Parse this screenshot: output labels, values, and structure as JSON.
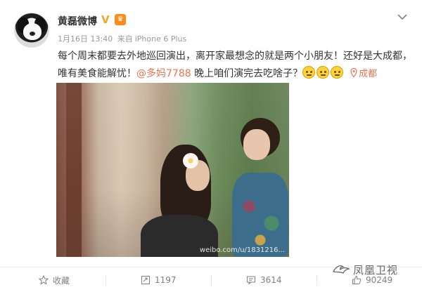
{
  "post": {
    "username": "黄磊微博",
    "verified_badge": "V",
    "member_badge": "vip",
    "date": "1月16日 13:40",
    "source_prefix": "来自",
    "source": "iPhone 6 Plus",
    "text_part1": "每个周末都要去外地巡回演出，离开家最想念的就是两个小朋友！还好是大成都，唯有美食能解忧！",
    "mention": "@多妈7788",
    "text_part2": " 晚上咱们演完去吃啥子？",
    "emoji_icons": [
      "doge-emoji",
      "doge-emoji",
      "doge-emoji"
    ],
    "location": "成都",
    "photo_watermark": "weibo.com/u/1831216..."
  },
  "actions": {
    "favorite_label": "收藏",
    "repost_count": "1197",
    "comment_count": "3614",
    "like_count": "90249"
  },
  "brand": {
    "name": "凤凰卫视"
  },
  "colors": {
    "accent": "#eb7350",
    "text": "#333333",
    "meta": "#999999"
  }
}
